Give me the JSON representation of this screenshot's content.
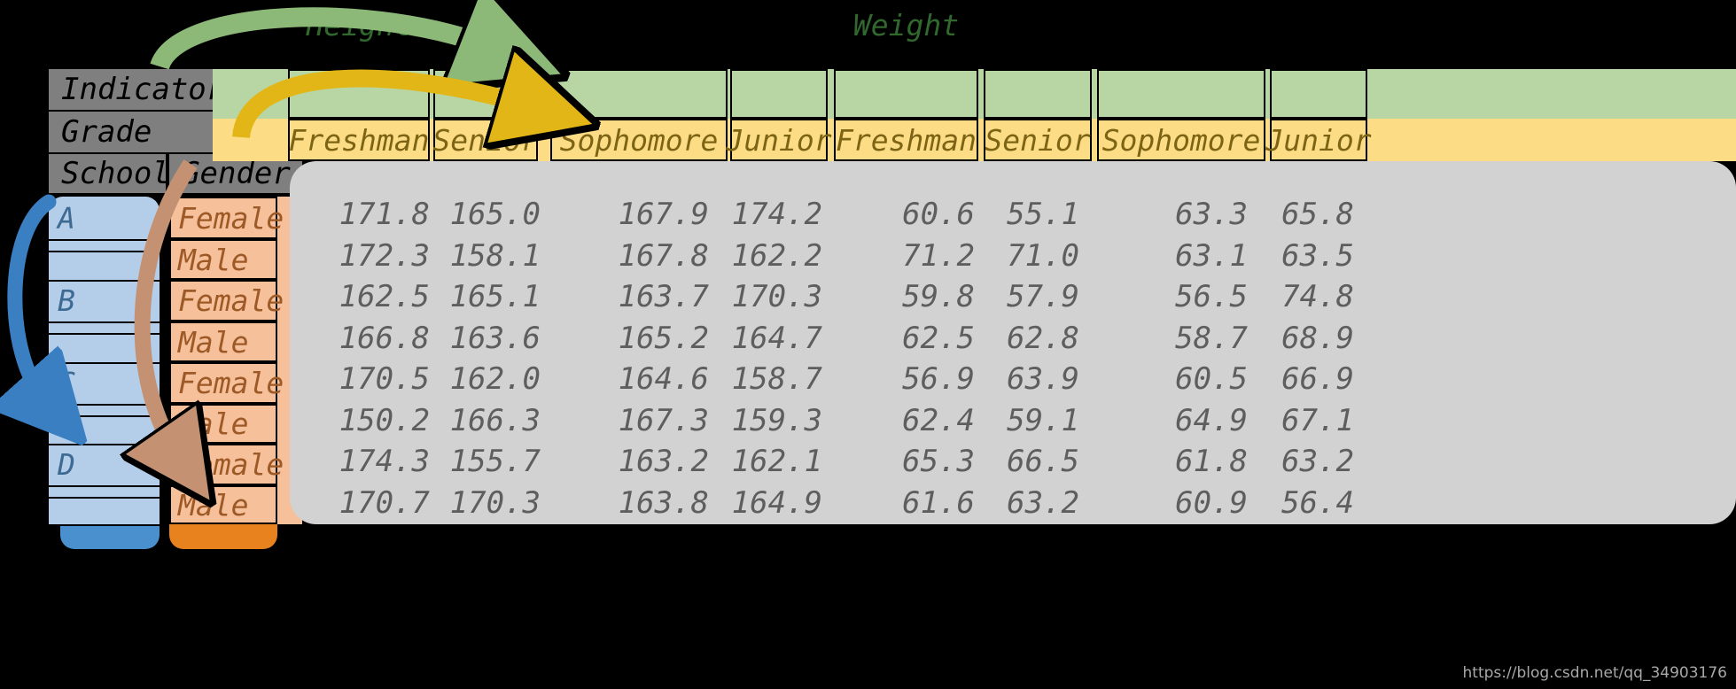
{
  "corner_labels": {
    "indicator": "Indicator",
    "grade": "Grade",
    "school": "School",
    "gender": "Gender"
  },
  "indicators": [
    {
      "label": "Height",
      "span": 4
    },
    {
      "label": "Weight",
      "span": 4
    }
  ],
  "grades": [
    "Freshman",
    "Senior",
    "Sophomore",
    "Junior",
    "Freshman",
    "Senior",
    "Sophomore",
    "Junior"
  ],
  "schools": [
    "A",
    "B",
    "C",
    "D"
  ],
  "genders": [
    "Female",
    "Male",
    "Female",
    "Male",
    "Female",
    "Male",
    "Female",
    "Male"
  ],
  "rows": [
    {
      "school": "A",
      "gender": "Female",
      "values": [
        "171.8",
        "165.0",
        "167.9",
        "174.2",
        "60.6",
        "55.1",
        "63.3",
        "65.8"
      ]
    },
    {
      "school": "A",
      "gender": "Male",
      "values": [
        "172.3",
        "158.1",
        "167.8",
        "162.2",
        "71.2",
        "71.0",
        "63.1",
        "63.5"
      ]
    },
    {
      "school": "B",
      "gender": "Female",
      "values": [
        "162.5",
        "165.1",
        "163.7",
        "170.3",
        "59.8",
        "57.9",
        "56.5",
        "74.8"
      ]
    },
    {
      "school": "B",
      "gender": "Male",
      "values": [
        "166.8",
        "163.6",
        "165.2",
        "164.7",
        "62.5",
        "62.8",
        "58.7",
        "68.9"
      ]
    },
    {
      "school": "C",
      "gender": "Female",
      "values": [
        "170.5",
        "162.0",
        "164.6",
        "158.7",
        "56.9",
        "63.9",
        "60.5",
        "66.9"
      ]
    },
    {
      "school": "C",
      "gender": "Male",
      "values": [
        "150.2",
        "166.3",
        "167.3",
        "159.3",
        "62.4",
        "59.1",
        "64.9",
        "67.1"
      ]
    },
    {
      "school": "D",
      "gender": "Female",
      "values": [
        "174.3",
        "155.7",
        "163.2",
        "162.1",
        "65.3",
        "66.5",
        "61.8",
        "63.2"
      ]
    },
    {
      "school": "D",
      "gender": "Male",
      "values": [
        "170.7",
        "170.3",
        "163.8",
        "164.9",
        "61.6",
        "63.2",
        "60.9",
        "56.4"
      ]
    }
  ],
  "annotations": {
    "green_arrow_name": "indicator-to-height-arrow",
    "yellow_arrow_name": "indicator-to-grade-arrow",
    "blue_arrow_name": "school-index-arrow",
    "brown_arrow_name": "gender-index-arrow"
  },
  "colors": {
    "background": "#000000",
    "header_grey": "#7f7f7f",
    "indicator_green": "#b8d6a4",
    "indicator_green_text": "#31682e",
    "grade_yellow": "#fcdd86",
    "grade_yellow_text": "#7d6414",
    "school_blue": "#b4cde8",
    "school_blue_dark": "#4a90cf",
    "gender_orange": "#f5c09a",
    "gender_orange_dark": "#e8821e",
    "body_grey": "#d2d2d2",
    "body_text": "#5e5e5e",
    "green_arrow": "#8cb878",
    "yellow_arrow": "#e3b617",
    "blue_arrow": "#3a7fc1",
    "brown_arrow": "#c49272"
  },
  "watermark": "https://blog.csdn.net/qq_34903176"
}
